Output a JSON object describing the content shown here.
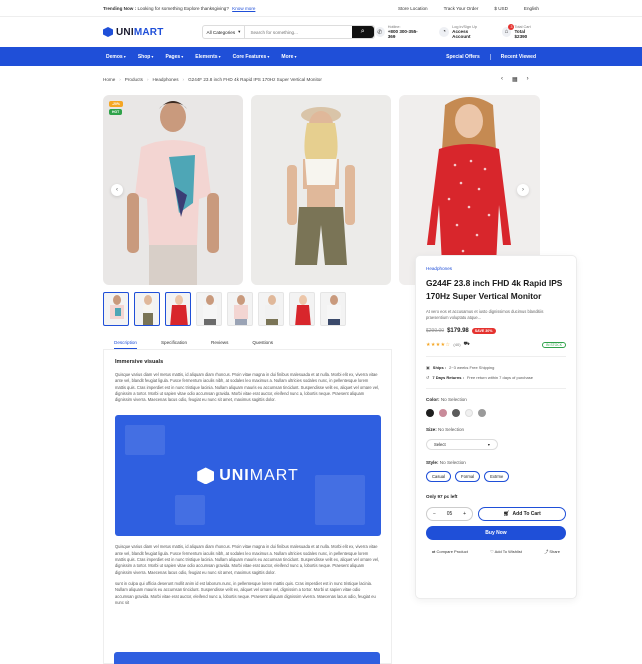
{
  "topbar": {
    "trending_label": "Trending Now :",
    "trending_text": "Looking for something Explore thanksgiving?",
    "trending_link": "Know more",
    "links": [
      "Store Location",
      "Track Your Order",
      "$ USD",
      "English"
    ]
  },
  "header": {
    "logo_prefix": "UNI",
    "logo_suffix": "MART",
    "category": "All Categories",
    "search_placeholder": "Search for something...",
    "hotline_label": "Hotline:",
    "hotline_value": "+800 300-355-369",
    "login_label": "Log in/Sign Up",
    "login_value": "Access Account",
    "cart_label": "Total Cart",
    "cart_value": "Total $2390",
    "cart_count": "3"
  },
  "nav": {
    "menu": [
      "Demos",
      "Shop",
      "Pages",
      "Elements",
      "Core Features",
      "More"
    ],
    "right": [
      "Special Offers",
      "Recent Viewed"
    ]
  },
  "breadcrumb": [
    "Home",
    "Products",
    "Headphones",
    "G244F 23.8 inch FHD 4k Rapid IPS 170Hz Super Vertical Monitor"
  ],
  "gallery": {
    "badges": [
      "-20%",
      "HOT"
    ]
  },
  "tabs": [
    "Description",
    "Specification",
    "Reviews",
    "Questions"
  ],
  "description": {
    "heading": "Immersive visuals",
    "para1": "Quisque varius diam vel metus mattis, id aliquam diam rhoncus. Proin vitae magna in dui finibus malesuada et at nulla. Morbi elit ex, viverra vitae ante vel, blandit feugiat ligula. Fusce fermentum iaculis nibh, at sodales leo maximus a. Nullam ultricies sodales nunc, in pellentesque lorem mattis quis. Cras imperdiet est in nunc tristique lacinia. Nullam aliquam mauris eu accumsan tincidunt. Suspendisse velit ex, aliquet vel ornare vel, dignissim a tortor. Morbi ut sapien vitae odio accumsan gravida. Morbi vitae erat auctor, eleifend nunc a, lobortis neque. Praesent aliquam dignissim viverra. Maecenas lacus odio, feugiat eu nunc sit amet, maximus sagittis dolor.",
    "banner_prefix": "UNI",
    "banner_suffix": "MART",
    "para2": "Quisque varius diam vel metus mattis, id aliquam diam rhoncus. Proin vitae magna in dui finibus malesuada et at nulla. Morbi elit ex, viverra vitae ante vel, blandit feugiat ligula. Fusce fermentum iaculis nibh, at sodales leo maximus a. Nullam ultricies sodales nunc, in pellentesque lorem mattis quis. Cras imperdiet est in nunc tristique lacinia. Nullam aliquam mauris eu accumsan tincidunt. Suspendisse velit ex, aliquet vel ornare vel, dignissim a tortor. Morbi ut sapien vitae odio accumsan gravida. Morbi vitae erat auctor, eleifend nunc a, lobortis neque. Praesent aliquam dignissim viverra. Maecenas lacus odio, feugiat eu nunc sit amet, maximus sagittis dolor.",
    "para3": "sunt in culpa qui officia deserunt mollit anim id est laborum.nunc, in pellentesque lorem mattis quis. Cras imperdiet est in nunc tristique lacinia. Nullam aliquam mauris eu accumsan tincidunt. Suspendisse velit ex, aliquet vel ornare vel, dignissim a tortor. Morbi ut sapien vitae odio accumsan gravida. Morbi vitae erat auctor, eleifend nunc a, lobortis neque. Praesent aliquam dignissim viverra. Maecenas lacus odio, feugiat eu nunc sit"
  },
  "product": {
    "category": "Headphones",
    "title": "G244F 23.8 inch FHD 4k Rapid IPS 170Hz Super Vertical Monitor",
    "subtitle": "At vero eos et accusamus et iusto dignissimos ducimus blanditiis praesentium voluptatu atque...",
    "old_price": "$299.00",
    "new_price": "$179.98",
    "discount": "SAVE 30%",
    "stars": "★★★★☆",
    "reviews": "(40)",
    "stock": "IN STOCK",
    "ships_label": "Ships :",
    "ships_text": "2~3 weeks Free Shipping",
    "returns_label": "7 Days Returns :",
    "returns_text": "Free return within 7 days of purchase",
    "color_label": "Color:",
    "color_value": "No Selection",
    "colors": [
      "#1e1e1e",
      "#c98b9a",
      "#5b5b5b",
      "#f0f0f0",
      "#9a9a9a"
    ],
    "size_label": "Size:",
    "size_value": "No Selection",
    "size_select": "Select",
    "style_label": "Style:",
    "style_value": "No Selection",
    "styles": [
      "Casual",
      "Formal",
      "Extrme"
    ],
    "stock_left": "Only 97 pc left",
    "qty": "05",
    "qty_minus": "−",
    "qty_plus": "+",
    "add_to_cart": "Add To Cart",
    "buy_now": "Buy Now",
    "actions": [
      "Compare Product",
      "Add To Wishlist",
      "Share"
    ]
  },
  "colors": {
    "accent": "#1f4fd8",
    "sale": "#e5322f"
  }
}
